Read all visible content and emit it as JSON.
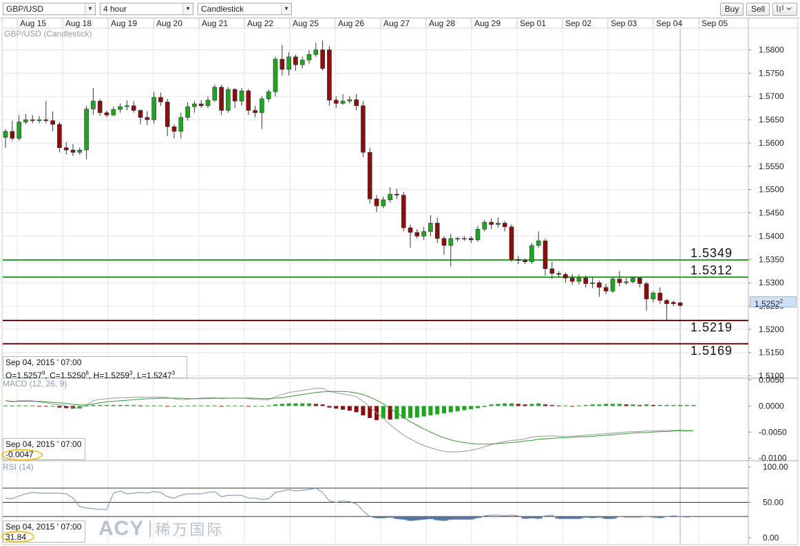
{
  "toolbar": {
    "symbol": "GBP/USD",
    "interval": "4 hour",
    "chart_style": "Candlestick",
    "buy_label": "Buy",
    "sell_label": "Sell"
  },
  "chart_title": "GBP/USD (Candlestick)",
  "price_tag": "1.5252",
  "price_tag_sup": "2",
  "ohlc_box": {
    "date": "Sep 04, 2015 ' 07:00",
    "o": "1.5257",
    "o_sup": "9",
    "c": "1.5250",
    "c_sup": "6",
    "h": "1.5259",
    "h_sup": "3",
    "l": "1.5247",
    "l_sup": "3"
  },
  "macd_box": {
    "date": "Sep 04, 2015 ' 07:00",
    "value": "-0.0047"
  },
  "rsi_box": {
    "date": "Sep 04, 2015 ' 07:00",
    "value": "31.84"
  },
  "watermark": {
    "latin": "ACY",
    "cn": "稀万国际"
  },
  "colors": {
    "up": "#1fa51f",
    "down": "#8b0f0f",
    "support": "#7a0a0a",
    "resistance": "#2aa52a",
    "grid": "#e4e4e4",
    "signal_line": "#2e9b2e",
    "macd_line": "#999999",
    "rsi_line": "#6f8fb6",
    "rsi_fill": "#5575a5"
  },
  "chart_data": [
    {
      "type": "candlestick",
      "title": "GBP/USD (Candlestick)",
      "x_labels": [
        "Aug 15",
        "Aug 18",
        "Aug 19",
        "Aug 20",
        "Aug 21",
        "Aug 22",
        "Aug 25",
        "Aug 26",
        "Aug 27",
        "Aug 28",
        "Aug 29",
        "Sep 01",
        "Sep 02",
        "Sep 03",
        "Sep 04",
        "Sep 05"
      ],
      "y_ticks": [
        "1.5800",
        "1.5750",
        "1.5700",
        "1.5650",
        "1.5600",
        "1.5550",
        "1.5500",
        "1.5450",
        "1.5400",
        "1.5350",
        "1.5300",
        "1.5250",
        "1.5200",
        "1.5150",
        "1.5100"
      ],
      "ylim": [
        1.5095,
        1.5845
      ],
      "grid": true,
      "candles": [
        [
          1.5612,
          1.5625,
          1.559,
          1.563
        ],
        [
          1.5625,
          1.561,
          1.5605,
          1.5648
        ],
        [
          1.561,
          1.5645,
          1.5605,
          1.566
        ],
        [
          1.5645,
          1.565,
          1.564,
          1.5662
        ],
        [
          1.565,
          1.5648,
          1.5642,
          1.566
        ],
        [
          1.5648,
          1.565,
          1.5642,
          1.5658
        ],
        [
          1.565,
          1.5648,
          1.5642,
          1.569
        ],
        [
          1.5648,
          1.564,
          1.5625,
          1.5668
        ],
        [
          1.564,
          1.559,
          1.558,
          1.5645
        ],
        [
          1.559,
          1.5585,
          1.5575,
          1.5602
        ],
        [
          1.5585,
          1.558,
          1.5572,
          1.5598
        ],
        [
          1.558,
          1.5585,
          1.5575,
          1.559
        ],
        [
          1.5585,
          1.5673,
          1.5565,
          1.568
        ],
        [
          1.5673,
          1.569,
          1.566,
          1.5718
        ],
        [
          1.569,
          1.5665,
          1.5658,
          1.5695
        ],
        [
          1.5665,
          1.566,
          1.5655,
          1.567
        ],
        [
          1.566,
          1.5672,
          1.5658,
          1.5678
        ],
        [
          1.5672,
          1.5678,
          1.5665,
          1.5685
        ],
        [
          1.5678,
          1.568,
          1.567,
          1.5692
        ],
        [
          1.568,
          1.567,
          1.5665,
          1.569
        ],
        [
          1.567,
          1.5655,
          1.564,
          1.5672
        ],
        [
          1.5655,
          1.565,
          1.5638,
          1.5668
        ],
        [
          1.565,
          1.5698,
          1.5642,
          1.571
        ],
        [
          1.5698,
          1.5688,
          1.568,
          1.5708
        ],
        [
          1.5688,
          1.5635,
          1.5615,
          1.5695
        ],
        [
          1.5635,
          1.5625,
          1.561,
          1.564
        ],
        [
          1.5625,
          1.5655,
          1.561,
          1.5665
        ],
        [
          1.5655,
          1.5678,
          1.5648,
          1.5688
        ],
        [
          1.5678,
          1.5684,
          1.5665,
          1.569
        ],
        [
          1.5684,
          1.568,
          1.5675,
          1.5692
        ],
        [
          1.568,
          1.5692,
          1.5675,
          1.57
        ],
        [
          1.5692,
          1.572,
          1.5688,
          1.5725
        ],
        [
          1.572,
          1.567,
          1.566,
          1.5725
        ],
        [
          1.567,
          1.5715,
          1.5665,
          1.572
        ],
        [
          1.5715,
          1.569,
          1.5675,
          1.5718
        ],
        [
          1.569,
          1.5712,
          1.568,
          1.5718
        ],
        [
          1.5712,
          1.567,
          1.566,
          1.5716
        ],
        [
          1.567,
          1.5665,
          1.5655,
          1.568
        ],
        [
          1.5665,
          1.5695,
          1.563,
          1.57
        ],
        [
          1.5695,
          1.571,
          1.5688,
          1.5715
        ],
        [
          1.571,
          1.578,
          1.57,
          1.5785
        ],
        [
          1.578,
          1.5758,
          1.5745,
          1.581
        ],
        [
          1.5758,
          1.5785,
          1.5745,
          1.5795
        ],
        [
          1.5785,
          1.5768,
          1.5755,
          1.579
        ],
        [
          1.5768,
          1.5778,
          1.576,
          1.5785
        ],
        [
          1.5778,
          1.579,
          1.577,
          1.58
        ],
        [
          1.579,
          1.58,
          1.5785,
          1.5815
        ],
        [
          1.58,
          1.576,
          1.5755,
          1.582
        ],
        [
          1.58,
          1.5692,
          1.568,
          1.5808
        ],
        [
          1.5692,
          1.5685,
          1.5675,
          1.57
        ],
        [
          1.5685,
          1.569,
          1.5682,
          1.5705
        ],
        [
          1.569,
          1.5693,
          1.5685,
          1.57
        ],
        [
          1.5693,
          1.568,
          1.567,
          1.5705
        ],
        [
          1.568,
          1.558,
          1.557,
          1.569
        ],
        [
          1.558,
          1.548,
          1.547,
          1.559
        ],
        [
          1.548,
          1.5465,
          1.5452,
          1.5488
        ],
        [
          1.5465,
          1.5478,
          1.546,
          1.5485
        ],
        [
          1.5478,
          1.549,
          1.5472,
          1.5505
        ],
        [
          1.549,
          1.5488,
          1.548,
          1.5502
        ],
        [
          1.5488,
          1.5418,
          1.541,
          1.5495
        ],
        [
          1.5418,
          1.5408,
          1.5375,
          1.5425
        ],
        [
          1.5408,
          1.54,
          1.5395,
          1.5415
        ],
        [
          1.54,
          1.541,
          1.5392,
          1.542
        ],
        [
          1.541,
          1.5428,
          1.54,
          1.5445
        ],
        [
          1.5428,
          1.5395,
          1.5385,
          1.544
        ],
        [
          1.5395,
          1.538,
          1.536,
          1.54
        ],
        [
          1.538,
          1.5395,
          1.5335,
          1.5405
        ],
        [
          1.5395,
          1.5394,
          1.5388,
          1.5398
        ],
        [
          1.5394,
          1.5395,
          1.539,
          1.54
        ],
        [
          1.5395,
          1.5392,
          1.5385,
          1.54
        ],
        [
          1.5392,
          1.5415,
          1.5388,
          1.5422
        ],
        [
          1.5415,
          1.543,
          1.541,
          1.5435
        ],
        [
          1.543,
          1.5425,
          1.5415,
          1.5438
        ],
        [
          1.5425,
          1.5428,
          1.5418,
          1.544
        ],
        [
          1.5428,
          1.542,
          1.541,
          1.5432
        ],
        [
          1.542,
          1.535,
          1.5345,
          1.5425
        ],
        [
          1.535,
          1.5348,
          1.534,
          1.5358
        ],
        [
          1.5348,
          1.5345,
          1.534,
          1.5352
        ],
        [
          1.5345,
          1.538,
          1.534,
          1.5385
        ],
        [
          1.538,
          1.539,
          1.5375,
          1.541
        ],
        [
          1.539,
          1.533,
          1.5315,
          1.5395
        ],
        [
          1.533,
          1.532,
          1.5308,
          1.5345
        ],
        [
          1.532,
          1.5318,
          1.5312,
          1.5325
        ],
        [
          1.5318,
          1.531,
          1.53,
          1.5322
        ],
        [
          1.531,
          1.5303,
          1.5295,
          1.5318
        ],
        [
          1.5303,
          1.531,
          1.5296,
          1.5318
        ],
        [
          1.531,
          1.5298,
          1.529,
          1.5315
        ],
        [
          1.5298,
          1.53,
          1.5288,
          1.5312
        ],
        [
          1.53,
          1.529,
          1.527,
          1.5305
        ],
        [
          1.529,
          1.5282,
          1.5275,
          1.5298
        ],
        [
          1.5282,
          1.5308,
          1.5278,
          1.5312
        ],
        [
          1.5308,
          1.53,
          1.5292,
          1.5325
        ],
        [
          1.53,
          1.5302,
          1.5295,
          1.531
        ],
        [
          1.5302,
          1.531,
          1.5298,
          1.5312
        ],
        [
          1.531,
          1.5298,
          1.529,
          1.5312
        ],
        [
          1.5298,
          1.5265,
          1.524,
          1.5302
        ],
        [
          1.5265,
          1.5278,
          1.5258,
          1.5282
        ],
        [
          1.5278,
          1.5262,
          1.5255,
          1.529
        ],
        [
          1.5262,
          1.5255,
          1.5218,
          1.5265
        ],
        [
          1.5258,
          1.5255,
          1.525,
          1.5262
        ],
        [
          1.5257,
          1.5251,
          1.5247,
          1.5259
        ]
      ],
      "horizontal_levels": [
        {
          "value": 1.5349,
          "label": "1.5349",
          "kind": "resistance"
        },
        {
          "value": 1.5312,
          "label": "1.5312",
          "kind": "resistance"
        },
        {
          "value": 1.5219,
          "label": "1.5219",
          "kind": "support"
        },
        {
          "value": 1.5169,
          "label": "1.5169",
          "kind": "support"
        }
      ]
    },
    {
      "type": "bar",
      "title": "MACD (12, 26, 9)",
      "y_ticks": [
        "0.0050",
        "0.0000",
        "-0.0050",
        "-0.0100"
      ],
      "ylim": [
        -0.0105,
        0.0052
      ],
      "histogram": [
        0.0001,
        0.0001,
        0.0001,
        0.0001,
        0.0001,
        0,
        -0.0001,
        -0.0001,
        -0.0003,
        -0.0004,
        -0.0005,
        -0.0005,
        0.0001,
        0.0002,
        0.0002,
        0.0002,
        0.0002,
        0.0002,
        0.0002,
        0.0002,
        0.0001,
        0.0001,
        0.0001,
        0.0001,
        -0.0001,
        -0.0001,
        -0.0001,
        0.0001,
        0.0001,
        0.0001,
        0.0001,
        0.0001,
        -0.0001,
        0.0001,
        0.0001,
        0.0001,
        -0.0001,
        -0.0001,
        -0.0001,
        0.0001,
        0.0003,
        0.0004,
        0.0005,
        0.0005,
        0.0005,
        0.0005,
        0.0004,
        0.0003,
        -0.0003,
        -0.0005,
        -0.0007,
        -0.0009,
        -0.0012,
        -0.0018,
        -0.0023,
        -0.0027,
        -0.0024,
        -0.0026,
        -0.0025,
        -0.0024,
        -0.0023,
        -0.0022,
        -0.002,
        -0.0018,
        -0.0016,
        -0.0014,
        -0.0012,
        -0.001,
        -0.0008,
        -0.0006,
        -0.0004,
        -0.0002,
        0.0003,
        0.0004,
        0.0005,
        0.0005,
        0.0004,
        0.0003,
        0.0004,
        0.0005,
        0.0003,
        0.0002,
        0.0001,
        0.0001,
        -0.0001,
        0.0001,
        0.0002,
        0.0003,
        0.0003,
        0.0004,
        0.0004,
        0.0004,
        0.0003,
        0.0003,
        0.0002,
        0.0003,
        0.0002,
        0.0002,
        0.0002,
        0.0002,
        0.0002,
        0.0002,
        0.0002
      ],
      "macd_line": [
        0.001,
        0.0008,
        0.001,
        0.001,
        0.001,
        0.0008,
        0.0006,
        0.0004,
        0.0002,
        0.0,
        -0.0003,
        -0.0004,
        0.0002,
        0.001,
        0.0013,
        0.0014,
        0.0015,
        0.0016,
        0.0016,
        0.0017,
        0.0017,
        0.0017,
        0.0017,
        0.0017,
        0.0016,
        0.0014,
        0.0012,
        0.0013,
        0.0014,
        0.0015,
        0.0016,
        0.0016,
        0.0014,
        0.0015,
        0.0015,
        0.0015,
        0.0014,
        0.0013,
        0.0012,
        0.0012,
        0.0018,
        0.0022,
        0.0026,
        0.0028,
        0.003,
        0.0032,
        0.0034,
        0.0034,
        0.0028,
        0.0025,
        0.0023,
        0.0021,
        0.0018,
        0.0009,
        -0.0002,
        -0.0013,
        -0.0023,
        -0.0036,
        -0.0046,
        -0.0056,
        -0.0063,
        -0.007,
        -0.0076,
        -0.008,
        -0.0084,
        -0.0087,
        -0.0088,
        -0.0088,
        -0.0087,
        -0.0085,
        -0.0082,
        -0.0078,
        -0.0074,
        -0.0071,
        -0.0068,
        -0.0066,
        -0.0065,
        -0.0063,
        -0.006,
        -0.0058,
        -0.0058,
        -0.0057,
        -0.0058,
        -0.0058,
        -0.0058,
        -0.0057,
        -0.0056,
        -0.0055,
        -0.0054,
        -0.0053,
        -0.0052,
        -0.0051,
        -0.005,
        -0.0049,
        -0.0049,
        -0.0048,
        -0.0048,
        -0.0047,
        -0.0047,
        -0.0047,
        -0.0046,
        -0.0047,
        -0.0047
      ],
      "signal_line": [
        0.001,
        0.0009,
        0.0009,
        0.0009,
        0.0009,
        0.0009,
        0.0008,
        0.0007,
        0.0006,
        0.0005,
        0.0003,
        0.0002,
        0.0002,
        0.0004,
        0.0006,
        0.0008,
        0.0009,
        0.001,
        0.0011,
        0.0012,
        0.0013,
        0.0014,
        0.0014,
        0.0015,
        0.0015,
        0.0015,
        0.0015,
        0.0014,
        0.0014,
        0.0014,
        0.0014,
        0.0015,
        0.0015,
        0.0015,
        0.0015,
        0.0015,
        0.0015,
        0.0015,
        0.0014,
        0.0014,
        0.0015,
        0.0016,
        0.0018,
        0.002,
        0.0022,
        0.0024,
        0.0026,
        0.0027,
        0.0028,
        0.0028,
        0.0028,
        0.0027,
        0.0025,
        0.0022,
        0.0017,
        0.0011,
        0.0004,
        -0.0005,
        -0.0013,
        -0.0022,
        -0.003,
        -0.0037,
        -0.0044,
        -0.005,
        -0.0056,
        -0.0061,
        -0.0065,
        -0.0068,
        -0.007,
        -0.0072,
        -0.0073,
        -0.0073,
        -0.0073,
        -0.0072,
        -0.0071,
        -0.007,
        -0.0069,
        -0.0067,
        -0.0066,
        -0.0064,
        -0.0063,
        -0.0062,
        -0.0061,
        -0.0061,
        -0.006,
        -0.0059,
        -0.0059,
        -0.0058,
        -0.0057,
        -0.0056,
        -0.0055,
        -0.0054,
        -0.0053,
        -0.0052,
        -0.0051,
        -0.0051,
        -0.005,
        -0.0049,
        -0.0049,
        -0.0048,
        -0.0048,
        -0.0048,
        -0.0047
      ]
    },
    {
      "type": "line",
      "title": "RSI (14)",
      "y_ticks": [
        "100.00",
        "50.00",
        "0.00"
      ],
      "ylim": [
        0,
        100
      ],
      "levels": [
        70,
        50,
        30
      ],
      "values": [
        56,
        55,
        59,
        62,
        64,
        63,
        63,
        63,
        63,
        62,
        56,
        44,
        42,
        41,
        40,
        40,
        63,
        66,
        62,
        63,
        64,
        63,
        65,
        64,
        58,
        56,
        60,
        62,
        62,
        62,
        64,
        65,
        58,
        60,
        60,
        60,
        56,
        56,
        54,
        55,
        64,
        66,
        68,
        66,
        67,
        68,
        70,
        64,
        52,
        50,
        52,
        51,
        48,
        38,
        30,
        28,
        28,
        29,
        27,
        26,
        24,
        25,
        26,
        27,
        25,
        24,
        26,
        26,
        26,
        26,
        28,
        31,
        32,
        32,
        31,
        32,
        31,
        27,
        28,
        27,
        31,
        32,
        27,
        27,
        27,
        27,
        29,
        28,
        29,
        27,
        27,
        30,
        29,
        29,
        29,
        30,
        29,
        28,
        30,
        31,
        30,
        29,
        30
      ]
    }
  ]
}
